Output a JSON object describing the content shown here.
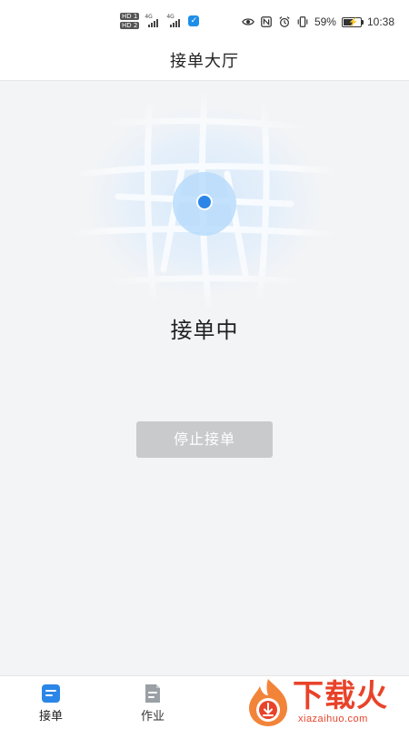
{
  "status_bar": {
    "hd_1": "HD 1",
    "hd_2": "HD 2",
    "net_1": "4G",
    "net_2": "4G",
    "battery_percent": "59%",
    "battery_level": 0.59,
    "time": "10:38",
    "icons": [
      "eye-icon",
      "nfc-icon",
      "alarm-icon",
      "vibrate-icon",
      "battery-icon"
    ]
  },
  "header": {
    "title": "接单大厅"
  },
  "main": {
    "status_text": "接单中",
    "stop_button_label": "停止接单",
    "colors": {
      "location_dot": "#2b86e8",
      "pulse": "#b9dcfb",
      "button_bg": "#c9cacc"
    }
  },
  "tabbar": {
    "tabs": [
      {
        "label": "接单",
        "icon": "order-list-icon",
        "active": true
      },
      {
        "label": "作业",
        "icon": "work-doc-icon",
        "active": false
      }
    ],
    "active_color": "#2b86e8",
    "inactive_color": "#9aa0a6"
  },
  "watermark": {
    "text": "下载火",
    "sub": "xiazaihuo.com"
  }
}
